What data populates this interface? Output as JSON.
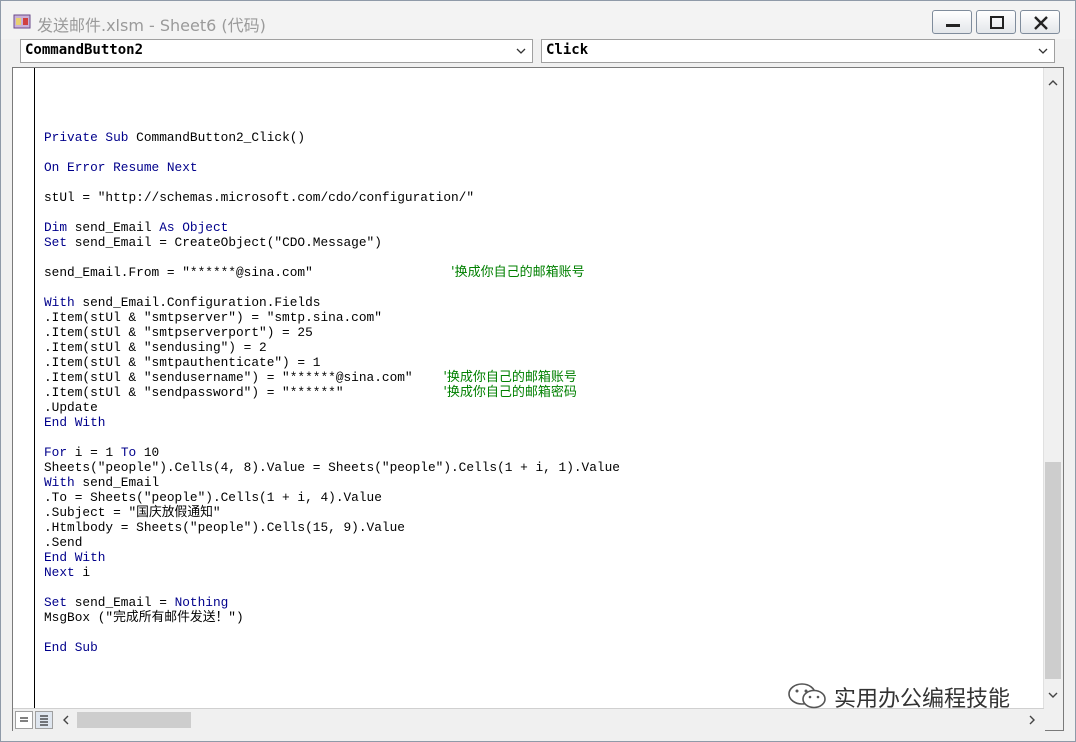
{
  "window": {
    "title": "发送邮件.xlsm - Sheet6 (代码)"
  },
  "object_combo": {
    "value": "CommandButton2"
  },
  "procedure_combo": {
    "value": "Click"
  },
  "code": {
    "lines": [
      {
        "t": ""
      },
      {
        "t": ""
      },
      {
        "k": "Private Sub",
        "t": " CommandButton2_Click()"
      },
      {
        "t": ""
      },
      {
        "k": "On Error Resume Next",
        "t": ""
      },
      {
        "t": ""
      },
      {
        "t": "stUl = \"http://schemas.microsoft.com/cdo/configuration/\""
      },
      {
        "t": ""
      },
      {
        "k": "Dim",
        "t": " send_Email ",
        "k2": "As Object"
      },
      {
        "k": "Set",
        "t": " send_Email = CreateObject(\"CDO.Message\")"
      },
      {
        "t": ""
      },
      {
        "t": "send_Email.From = \"******@sina.com\"                  ",
        "c": "'换成你自己的邮箱账号"
      },
      {
        "t": ""
      },
      {
        "k": "With",
        "t": " send_Email.Configuration.Fields"
      },
      {
        "t": ".Item(stUl & \"smtpserver\") = \"smtp.sina.com\""
      },
      {
        "t": ".Item(stUl & \"smtpserverport\") = 25"
      },
      {
        "t": ".Item(stUl & \"sendusing\") = 2"
      },
      {
        "t": ".Item(stUl & \"smtpauthenticate\") = 1"
      },
      {
        "t": ".Item(stUl & \"sendusername\") = \"******@sina.com\"    ",
        "c": "'换成你自己的邮箱账号"
      },
      {
        "t": ".Item(stUl & \"sendpassword\") = \"******\"             ",
        "c": "'换成你自己的邮箱密码"
      },
      {
        "t": ".Update"
      },
      {
        "k": "End With",
        "t": ""
      },
      {
        "t": ""
      },
      {
        "k": "For",
        "t": " i = 1 ",
        "k2": "To",
        "t2": " 10"
      },
      {
        "t": "Sheets(\"people\").Cells(4, 8).Value = Sheets(\"people\").Cells(1 + i, 1).Value"
      },
      {
        "k": "With",
        "t": " send_Email"
      },
      {
        "t": ".To = Sheets(\"people\").Cells(1 + i, 4).Value"
      },
      {
        "t": ".Subject = \"国庆放假通知\""
      },
      {
        "t": ".Htmlbody = Sheets(\"people\").Cells(15, 9).Value"
      },
      {
        "t": ".Send"
      },
      {
        "k": "End With",
        "t": ""
      },
      {
        "k": "Next",
        "t": " i"
      },
      {
        "t": ""
      },
      {
        "k": "Set",
        "t": " send_Email = ",
        "k2": "Nothing"
      },
      {
        "t": "MsgBox (\"完成所有邮件发送！\")"
      },
      {
        "t": ""
      },
      {
        "k": "End Sub",
        "t": ""
      }
    ]
  },
  "watermark": {
    "text": "实用办公编程技能"
  },
  "colors": {
    "keyword": "#00008b",
    "comment": "#008000",
    "text": "#000000"
  },
  "icons": [
    "excel-vba-icon",
    "minimize-icon",
    "maximize-icon",
    "close-icon",
    "chevron-down-icon",
    "scroll-up-icon",
    "scroll-down-icon",
    "scroll-left-icon",
    "scroll-right-icon",
    "procedure-view-icon",
    "full-module-view-icon",
    "wechat-icon"
  ]
}
